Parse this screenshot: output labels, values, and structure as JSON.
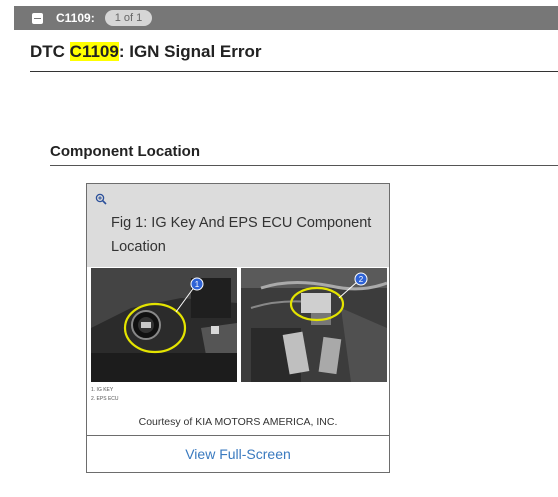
{
  "topbar": {
    "code_label": "C1109:",
    "pager": "1 of 1"
  },
  "title": {
    "prefix": "DTC ",
    "highlighted_code": "C1109",
    "suffix": ": IGN Signal Error"
  },
  "section": {
    "heading": "Component Location"
  },
  "figure": {
    "caption": "Fig 1: IG Key And EPS ECU Component Location",
    "legend": [
      "1. IG KEY",
      "2. EPS ECU"
    ],
    "callouts": [
      "1",
      "2"
    ],
    "courtesy": "Courtesy of KIA MOTORS AMERICA, INC.",
    "view_full_label": "View Full-Screen"
  },
  "colors": {
    "topbar": "#777777",
    "highlight": "#ffff00",
    "link": "#3a7abf",
    "callout_ring": "#e4e400",
    "callout_badge": "#2f63d6"
  },
  "icons": {
    "collapse": "minus-square-icon",
    "zoom": "zoom-in-icon"
  }
}
